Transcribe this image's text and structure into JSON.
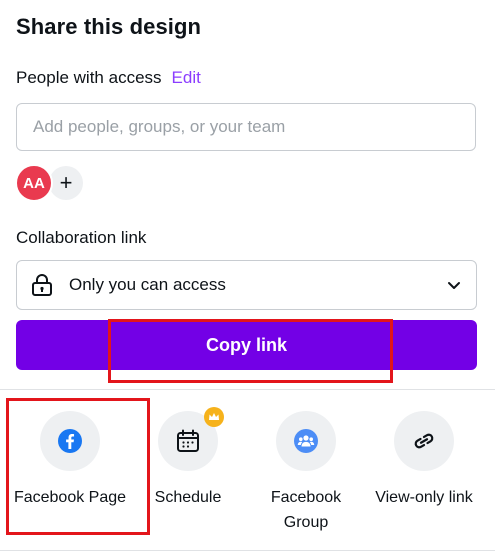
{
  "panel": {
    "title": "Share this design"
  },
  "access": {
    "label": "People with access",
    "edit_label": "Edit",
    "input_placeholder": "Add people, groups, or your team"
  },
  "avatars": {
    "initials": "AA",
    "add_symbol": "+"
  },
  "collaboration": {
    "label": "Collaboration link",
    "selected": "Only you can access"
  },
  "copy_button": {
    "label": "Copy link"
  },
  "share_options": [
    {
      "label": "Facebook Page",
      "icon": "facebook-icon"
    },
    {
      "label": "Schedule",
      "icon": "calendar-icon",
      "badge": "crown-icon"
    },
    {
      "label": "Facebook Group",
      "icon": "facebook-group-icon"
    },
    {
      "label": "View-only link",
      "icon": "link-icon"
    }
  ],
  "colors": {
    "accent": "#8b3dff",
    "copy_button": "#7300e6",
    "avatar": "#e93a4f",
    "facebook": "#1877f2",
    "group": "#4c8df6",
    "crown": "#f6b21b",
    "highlight": "#e3151b"
  }
}
